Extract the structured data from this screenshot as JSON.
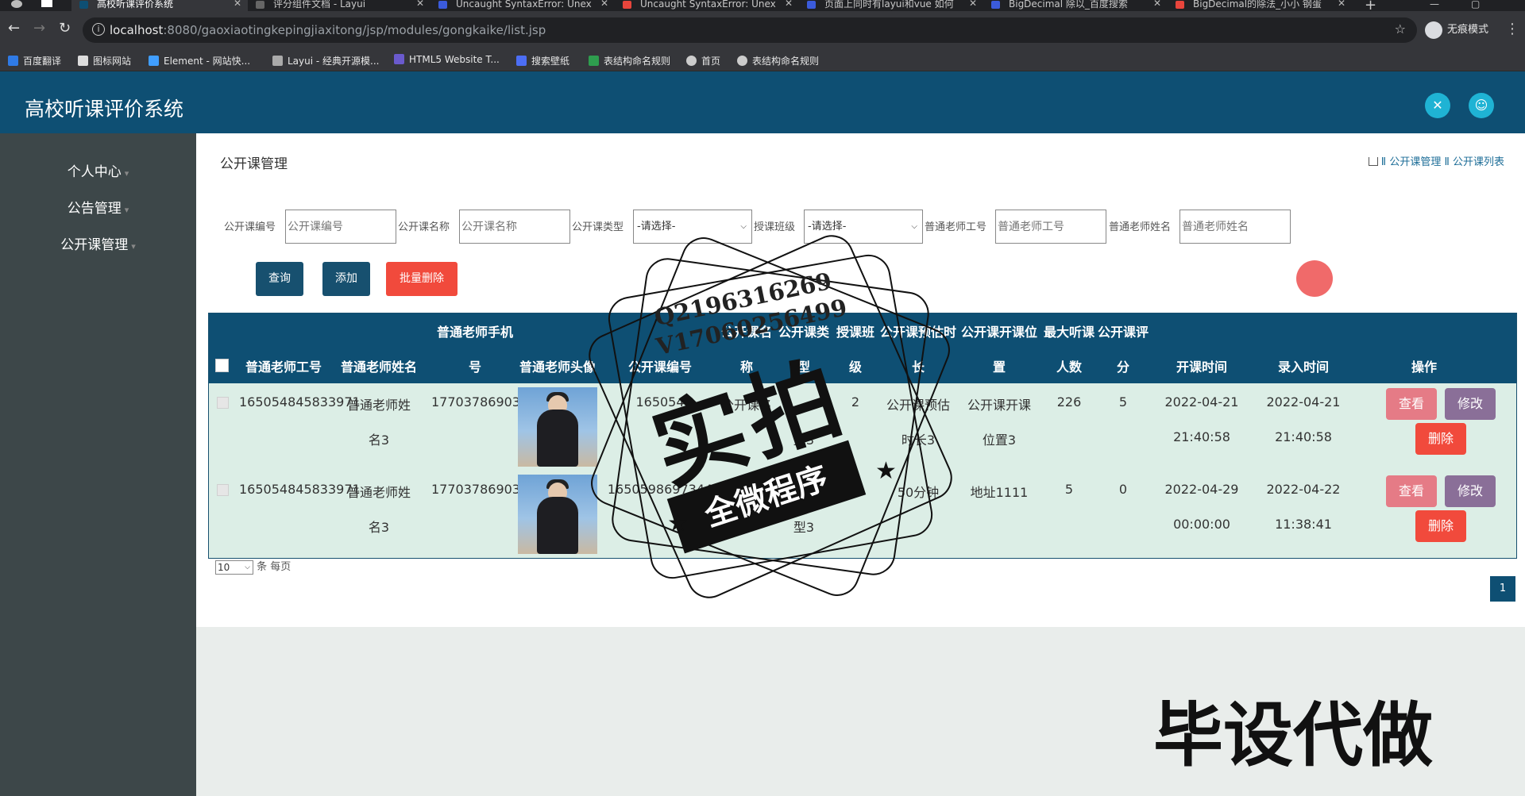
{
  "browser": {
    "tabs": [
      {
        "title": "高校听课评价系统",
        "color": "#0e4f73",
        "active": true
      },
      {
        "title": "评分组件文档 - Layui",
        "color": "#666"
      },
      {
        "title": "Uncaught SyntaxError: Unex",
        "color": "#3b5bdb"
      },
      {
        "title": "Uncaught SyntaxError: Unex",
        "color": "#e8453c"
      },
      {
        "title": "页面上同时有layui和vue 如何",
        "color": "#3b5bdb"
      },
      {
        "title": "BigDecimal 除以_百度搜索",
        "color": "#3b5bdb"
      },
      {
        "title": "BigDecimal的除法_小小 钢蛋",
        "color": "#e8453c"
      }
    ],
    "url_host": "localhost",
    "url_rest": ":8080/gaoxiaotingkepingjiaxitong/jsp/modules/gongkaike/list.jsp",
    "incognito_label": "无痕模式",
    "bookmarks": [
      {
        "label": "百度翻译",
        "color": "#2f7ae5"
      },
      {
        "label": "图标网站",
        "color": "#ddd"
      },
      {
        "label": "Element - 网站快...",
        "color": "#409eff"
      },
      {
        "label": "Layui - 经典开源模...",
        "color": "#aaa"
      },
      {
        "label": "HTML5 Website T...",
        "color": "#6a5acd"
      },
      {
        "label": "搜索壁纸",
        "color": "#4c6ef5"
      },
      {
        "label": "表结构命名规则",
        "color": "#2e9d4e"
      },
      {
        "label": "首页",
        "color": "#ccc"
      },
      {
        "label": "表结构命名规则",
        "color": "#ccc"
      }
    ]
  },
  "app": {
    "title": "高校听课评价系统",
    "sidebar": [
      {
        "label": "个人中心"
      },
      {
        "label": "公告管理"
      },
      {
        "label": "公开课管理"
      }
    ],
    "page_title": "公开课管理",
    "breadcrumb": "Ⅱ 公开课管理 Ⅱ 公开课列表"
  },
  "search": {
    "fields": [
      {
        "label": "公开课编号",
        "placeholder": "公开课编号"
      },
      {
        "label": "公开课名称",
        "placeholder": "公开课名称"
      },
      {
        "label": "公开课类型",
        "value": "-请选择-"
      },
      {
        "label": "授课班级",
        "value": "-请选择-"
      },
      {
        "label": "普通老师工号",
        "placeholder": "普通老师工号"
      },
      {
        "label": "普通老师姓名",
        "placeholder": "普通老师姓名"
      }
    ],
    "buttons": {
      "query": "查询",
      "add": "添加",
      "batch_delete": "批量删除"
    }
  },
  "table": {
    "header_top": {
      "c3": "普通老师手机",
      "c6": "公开课名",
      "c7": "公开课类",
      "c8": "授课班",
      "c9": "公开课预估时",
      "c10": "公开课开课位",
      "c11": "最大听课",
      "c12": "公开课评"
    },
    "header_bottom": {
      "c1": "普通老师工号",
      "c2": "普通老师姓名",
      "c3": "号",
      "c4": "普通老师头像",
      "c5": "公开课编号",
      "c6": "称",
      "c7": "型",
      "c8": "级",
      "c9": "长",
      "c10": "置",
      "c11": "人数",
      "c12": "分",
      "c13": "开课时间",
      "c14": "录入时间",
      "c15": "操作"
    },
    "rows": [
      {
        "teacher_id": "165054845833971",
        "teacher_name_1": "普通老师姓",
        "teacher_name_2": "名3",
        "phone": "17703786903",
        "course_id": "165054",
        "course_name": "公开课名",
        "course_type": "型3",
        "class_name": "2",
        "duration_1": "公开课预估",
        "duration_2": "时长3",
        "location_1": "公开课开课",
        "location_2": "位置3",
        "max_people": "226",
        "score": "5",
        "start_date": "2022-04-21",
        "start_time": "21:40:58",
        "entry_date": "2022-04-21",
        "entry_time": "21:40:58"
      },
      {
        "teacher_id": "165054845833971",
        "teacher_name_1": "普通老师姓",
        "teacher_name_2": "名3",
        "phone": "17703786903",
        "course_id": "1650598697344",
        "course_name": "公",
        "course_type": "型3",
        "class_name": "2",
        "duration_1": "50分钟",
        "duration_2": "",
        "location_1": "地址1111",
        "location_2": "",
        "max_people": "5",
        "score": "0",
        "start_date": "2022-04-29",
        "start_time": "00:00:00",
        "entry_date": "2022-04-22",
        "entry_time": "11:38:41"
      }
    ],
    "actions": {
      "view": "查看",
      "edit": "修改",
      "delete": "删除"
    }
  },
  "pager": {
    "page_size": "10",
    "per_page_label": "条 每页",
    "current_page": "1"
  },
  "watermark": {
    "qq": "Q2196316269",
    "vx": "V17060256499",
    "main": "实拍",
    "band": "全微程序",
    "corner": "毕设代做"
  }
}
